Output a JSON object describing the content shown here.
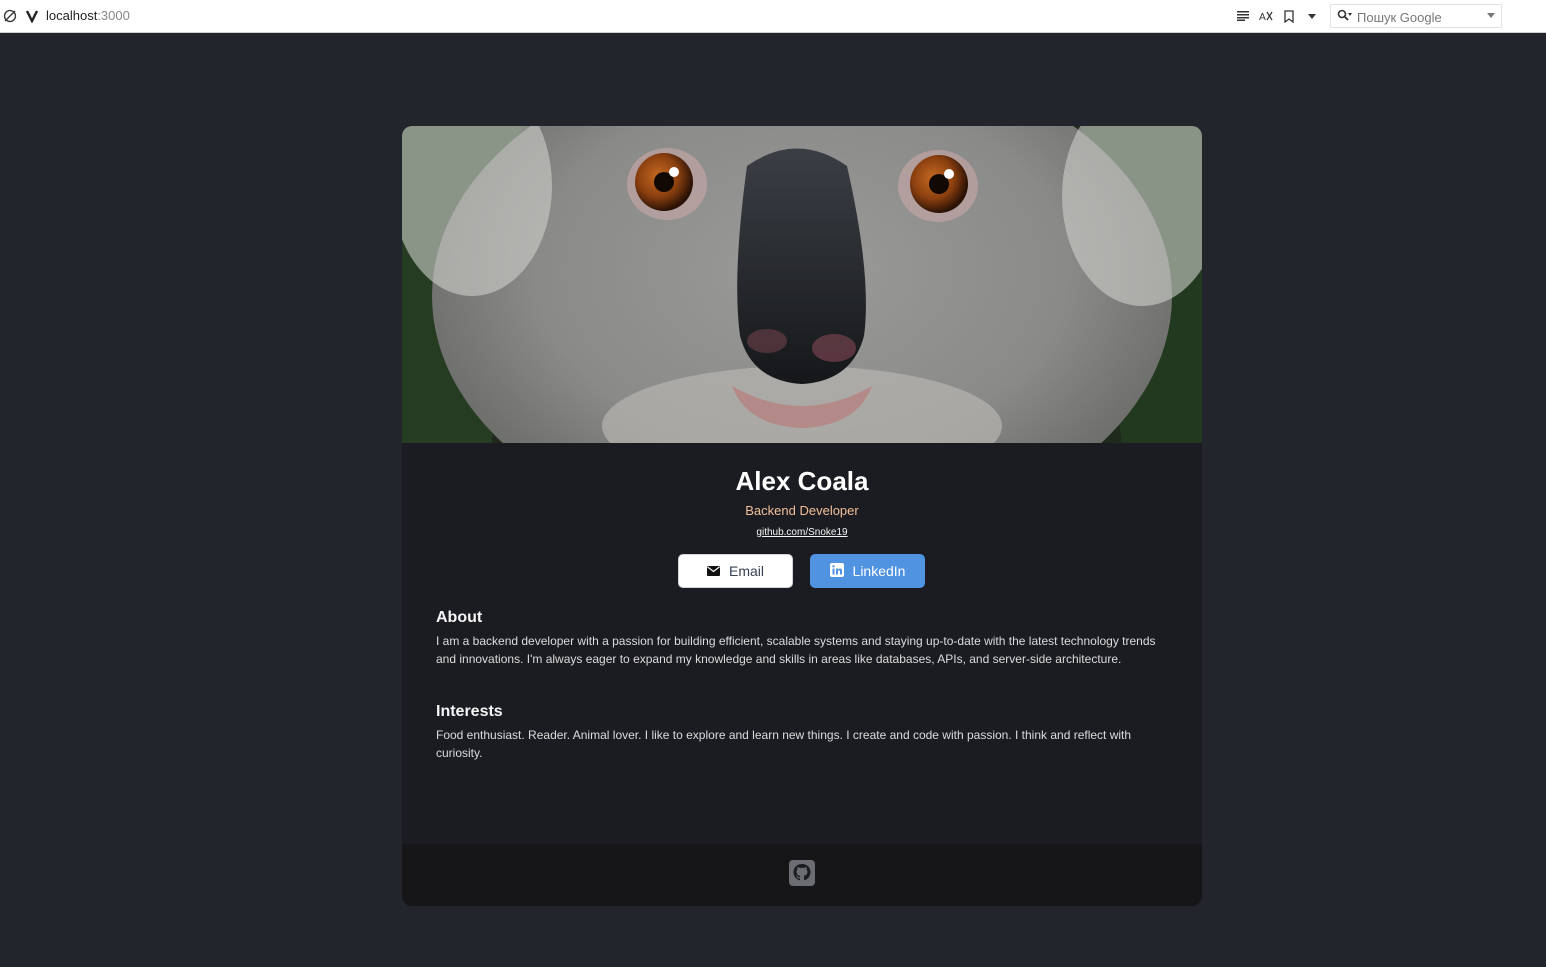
{
  "browser": {
    "url_host": "localhost",
    "url_port": ":3000",
    "search_placeholder": "Пошук Google"
  },
  "profile": {
    "name": "Alex Coala",
    "role": "Backend Developer",
    "github_text": "github.com/Snoke19"
  },
  "buttons": {
    "email_label": "Email",
    "linkedin_label": "LinkedIn"
  },
  "about": {
    "title": "About",
    "text": "I am a backend developer with a passion for building efficient, scalable systems and staying up-to-date with the latest technology trends and innovations. I'm always eager to expand my knowledge and skills in areas like databases, APIs, and server-side architecture."
  },
  "interests": {
    "title": "Interests",
    "text": "Food enthusiast. Reader. Animal lover. I like to explore and learn new things. I create and code with passion. I think and reflect with curiosity."
  },
  "colors": {
    "page_bg": "#23252c",
    "card_bg": "#1b1c21",
    "accent_role": "#f3bf99",
    "linkedin_blue": "#5093e1"
  },
  "icons": {
    "email": "mail-icon",
    "linkedin": "linkedin-icon",
    "footer": "github-icon"
  }
}
